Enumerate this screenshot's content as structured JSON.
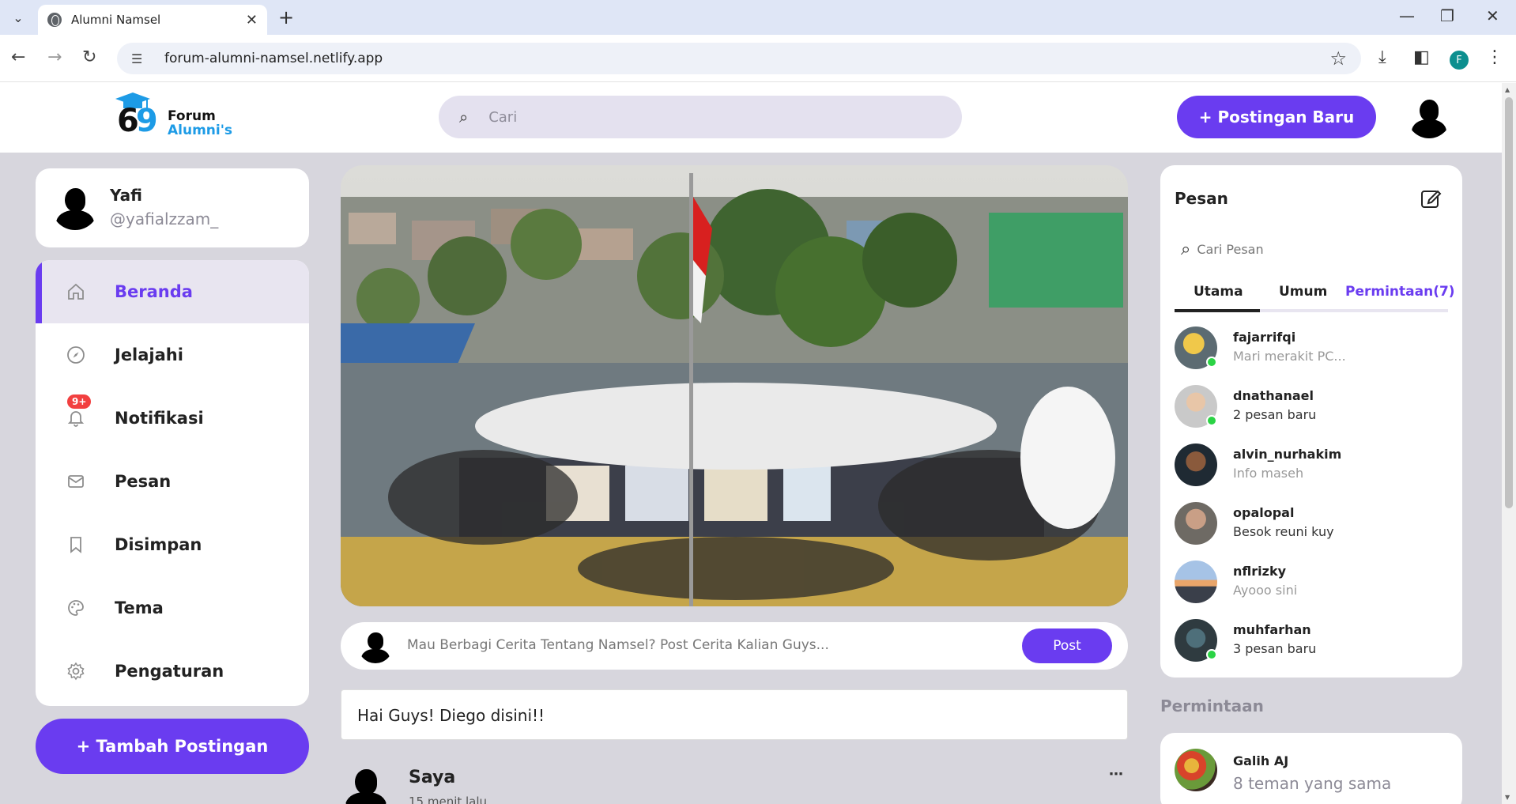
{
  "browser": {
    "tab_title": "Alumni Namsel",
    "url": "forum-alumni-namsel.netlify.app",
    "profile_initial": "F"
  },
  "header": {
    "logo_number": "69",
    "logo_line1": "Forum",
    "logo_line2": "Alumni's",
    "search_placeholder": "Cari",
    "new_post_label": "+ Postingan Baru"
  },
  "profile": {
    "name": "Yafi",
    "handle": "@yafialzzam_"
  },
  "menu": {
    "items": [
      {
        "label": "Beranda",
        "icon": "home-icon",
        "active": true
      },
      {
        "label": "Jelajahi",
        "icon": "compass-icon"
      },
      {
        "label": "Notifikasi",
        "icon": "bell-icon",
        "badge": "9+"
      },
      {
        "label": "Pesan",
        "icon": "mail-icon"
      },
      {
        "label": "Disimpan",
        "icon": "bookmark-icon"
      },
      {
        "label": "Tema",
        "icon": "palette-icon"
      },
      {
        "label": "Pengaturan",
        "icon": "gear-icon"
      }
    ],
    "add_post_label": "+ Tambah Postingan"
  },
  "composer": {
    "placeholder": "Mau Berbagi Cerita Tentang Namsel? Post Cerita Kalian Guys...",
    "post_label": "Post"
  },
  "story": {
    "text": "Hai Guys! Diego disini!!"
  },
  "feed_post": {
    "author": "Saya",
    "time": "15 menit lalu",
    "more": "⋯"
  },
  "messages": {
    "title": "Pesan",
    "search_placeholder": "Cari Pesan",
    "tabs": [
      "Utama",
      "Umum",
      "Permintaan(7)"
    ],
    "items": [
      {
        "username": "fajarrifqi",
        "preview": "Mari merakit PC...",
        "online": true,
        "muted": true
      },
      {
        "username": "dnathanael",
        "preview": "2 pesan baru",
        "online": true,
        "muted": false
      },
      {
        "username": "alvin_nurhakim",
        "preview": "Info maseh",
        "online": false,
        "muted": true
      },
      {
        "username": "opalopal",
        "preview": "Besok reuni kuy",
        "online": false,
        "muted": false
      },
      {
        "username": "nflrizky",
        "preview": "Ayooo sini",
        "online": false,
        "muted": true
      },
      {
        "username": "muhfarhan",
        "preview": "3 pesan baru",
        "online": true,
        "muted": false
      }
    ]
  },
  "requests": {
    "title": "Permintaan",
    "items": [
      {
        "name": "Galih AJ",
        "mutual": "8 teman yang sama"
      }
    ]
  },
  "colors": {
    "accent": "#6a3cf0",
    "page_bg": "#d7d6dd",
    "online": "#2bd345",
    "badge": "#f24040"
  }
}
